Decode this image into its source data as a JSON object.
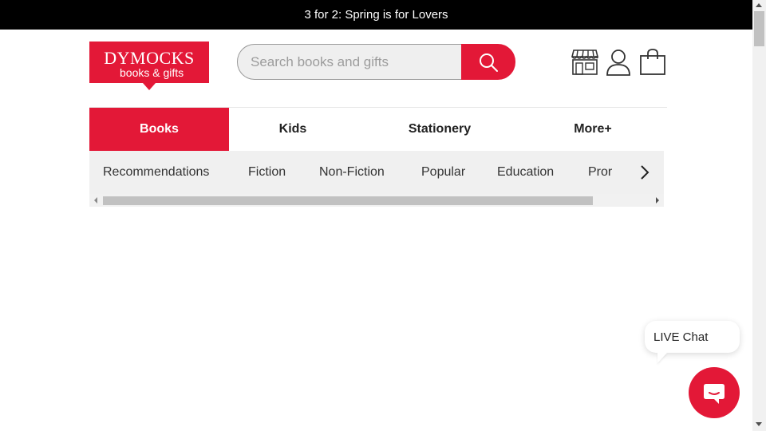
{
  "promo": {
    "text": "3 for 2: Spring is for Lovers"
  },
  "logo": {
    "brand": "DYMOCKS",
    "tagline": "books & gifts"
  },
  "search": {
    "placeholder": "Search books and gifts"
  },
  "icons": {
    "store": "store-icon",
    "account": "user-icon",
    "cart": "bag-icon",
    "search": "search-icon",
    "next": "chevron-right-icon",
    "chat": "chat-icon"
  },
  "main_nav": {
    "tabs": [
      {
        "label": "Books",
        "active": true
      },
      {
        "label": "Kids"
      },
      {
        "label": "Stationery"
      },
      {
        "label": "More+"
      }
    ]
  },
  "sub_nav": {
    "items": [
      "Recommendations",
      "Fiction",
      "Non-Fiction",
      "Popular",
      "Education",
      "Pror"
    ]
  },
  "chat": {
    "label": "LIVE Chat"
  },
  "colors": {
    "brand": "#e31837",
    "promo_bg": "#000000",
    "subnav_bg": "#f0f0f0"
  }
}
